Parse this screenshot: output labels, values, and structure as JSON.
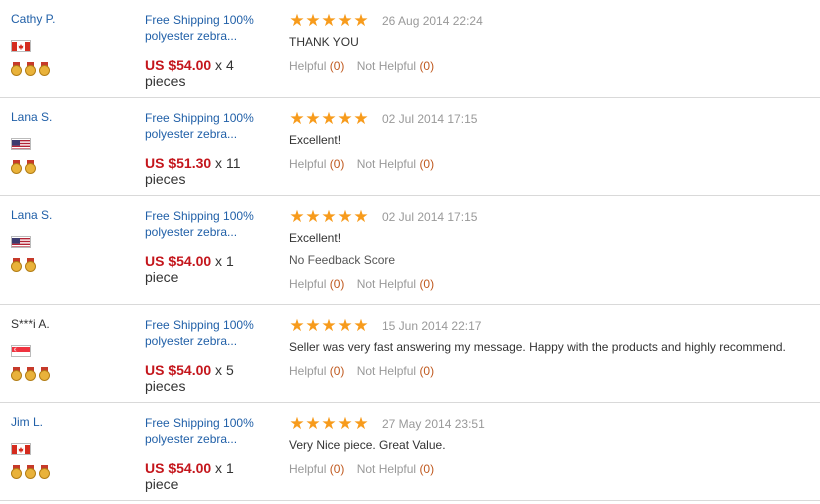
{
  "reviews": [
    {
      "user": "Cathy P.",
      "country": "canada",
      "medals": 3,
      "product_line1": "Free Shipping 100%",
      "product_line2": "polyester zebra...",
      "price": "US $54.00",
      "qty_text": " x 4",
      "unit": "pieces",
      "rating": 5,
      "date": "26 Aug 2014 22:24",
      "comment": "THANK YOU",
      "extra": "",
      "helpful_label": "Helpful",
      "helpful_count": "(0)",
      "nothelpful_label": "Not Helpful",
      "nothelpful_count": "(0)"
    },
    {
      "user": "Lana S.",
      "country": "usa",
      "medals": 2,
      "product_line1": "Free Shipping 100%",
      "product_line2": "polyester zebra...",
      "price": "US $51.30",
      "qty_text": " x 11",
      "unit": "pieces",
      "rating": 5,
      "date": "02 Jul 2014 17:15",
      "comment": "Excellent!",
      "extra": "",
      "helpful_label": "Helpful",
      "helpful_count": "(0)",
      "nothelpful_label": "Not Helpful",
      "nothelpful_count": "(0)"
    },
    {
      "user": "Lana S.",
      "country": "usa",
      "medals": 2,
      "product_line1": "Free Shipping 100%",
      "product_line2": "polyester zebra...",
      "price": "US $54.00",
      "qty_text": " x 1",
      "unit": "piece",
      "rating": 5,
      "date": "02 Jul 2014 17:15",
      "comment": "Excellent!",
      "extra": "No Feedback Score",
      "helpful_label": "Helpful",
      "helpful_count": "(0)",
      "nothelpful_label": "Not Helpful",
      "nothelpful_count": "(0)"
    },
    {
      "user": "S***i A.",
      "country": "singapore",
      "medals": 3,
      "product_line1": "Free Shipping 100%",
      "product_line2": "polyester zebra...",
      "price": "US $54.00",
      "qty_text": " x 5",
      "unit": "pieces",
      "rating": 5,
      "date": "15 Jun 2014 22:17",
      "comment": "Seller was very fast answering my message. Happy with the products and highly recommend.",
      "extra": "",
      "helpful_label": "Helpful",
      "helpful_count": "(0)",
      "nothelpful_label": "Not Helpful",
      "nothelpful_count": "(0)"
    },
    {
      "user": "Jim L.",
      "country": "canada",
      "medals": 3,
      "product_line1": "Free Shipping 100%",
      "product_line2": "polyester zebra...",
      "price": "US $54.00",
      "qty_text": " x 1",
      "unit": "piece",
      "rating": 5,
      "date": "27 May 2014 23:51",
      "comment": "Very Nice piece. Great Value.",
      "extra": "",
      "helpful_label": "Helpful",
      "helpful_count": "(0)",
      "nothelpful_label": "Not Helpful",
      "nothelpful_count": "(0)"
    }
  ]
}
